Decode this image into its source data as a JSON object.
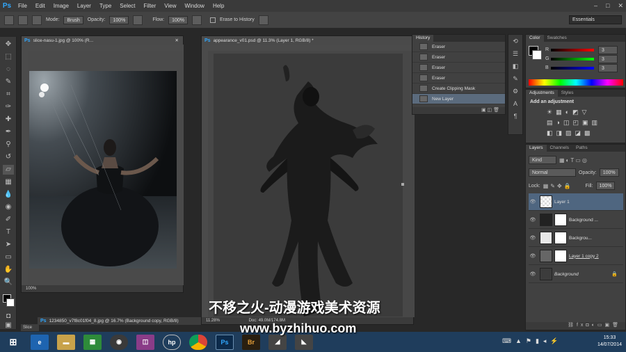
{
  "app": {
    "logo": "Ps"
  },
  "menu": [
    "File",
    "Edit",
    "Image",
    "Layer",
    "Type",
    "Select",
    "Filter",
    "View",
    "Window",
    "Help"
  ],
  "window_controls": {
    "minimize": "–",
    "maximize": "□",
    "close": "✕"
  },
  "options_bar": {
    "mode_label": "Mode:",
    "mode_value": "Brush",
    "opacity_label": "Opacity:",
    "opacity_value": "100%",
    "flow_label": "Flow:",
    "flow_value": "100%",
    "erase_history_label": "Erase to History"
  },
  "workspace": "Essentials",
  "doc1": {
    "title": "slice-nasu-1.jpg @ 100% (R...",
    "zoom": "100%"
  },
  "doc2": {
    "title": "appearance_v01.psd @ 11.3% (Layer 1, RGB/8) *",
    "zoom": "11.28%",
    "docinfo": "Doc: 49.0M/174.8M"
  },
  "doc3": {
    "title": "1234850_v7f8c01f04_8.jpg @ 16.7% (Background copy, RGB/8)"
  },
  "minimized_doc": "Slice",
  "history": {
    "tab": "History",
    "items": [
      {
        "label": "Eraser",
        "selected": false
      },
      {
        "label": "Eraser",
        "selected": false
      },
      {
        "label": "Eraser",
        "selected": false
      },
      {
        "label": "Eraser",
        "selected": false
      },
      {
        "label": "Create Clipping Mask",
        "selected": false
      },
      {
        "label": "New Layer",
        "selected": true
      }
    ]
  },
  "color_panel": {
    "tabs": [
      "Color",
      "Swatches"
    ],
    "channels": [
      {
        "label": "R",
        "value": "3"
      },
      {
        "label": "G",
        "value": "3"
      },
      {
        "label": "B",
        "value": "3"
      }
    ]
  },
  "adjustments_panel": {
    "tabs": [
      "Adjustments",
      "Styles"
    ],
    "heading": "Add an adjustment"
  },
  "layers_panel": {
    "tabs": [
      "Layers",
      "Channels",
      "Paths"
    ],
    "kind": "Kind",
    "blend": "Normal",
    "opacity_label": "Opacity:",
    "opacity_value": "100%",
    "lock_label": "Lock:",
    "fill_label": "Fill:",
    "fill_value": "100%",
    "layers": [
      {
        "name": "Layer 1",
        "selected": true
      },
      {
        "name": "Background ...",
        "selected": false
      },
      {
        "name": "Backgrou...",
        "selected": false
      },
      {
        "name": "Layer 1 copy 2",
        "selected": false
      },
      {
        "name": "Background",
        "selected": false
      }
    ]
  },
  "taskbar": {
    "apps": [
      "Ps",
      "Br"
    ],
    "time": "15:33",
    "date": "14/07/2014"
  },
  "watermark": {
    "line1": "不移之火-动漫游戏美术资源",
    "line2": "www.byzhihuo.com"
  },
  "colors": {
    "accent": "#31a8ff",
    "selection": "#4f6680",
    "taskbar": "#1f3d5c"
  }
}
